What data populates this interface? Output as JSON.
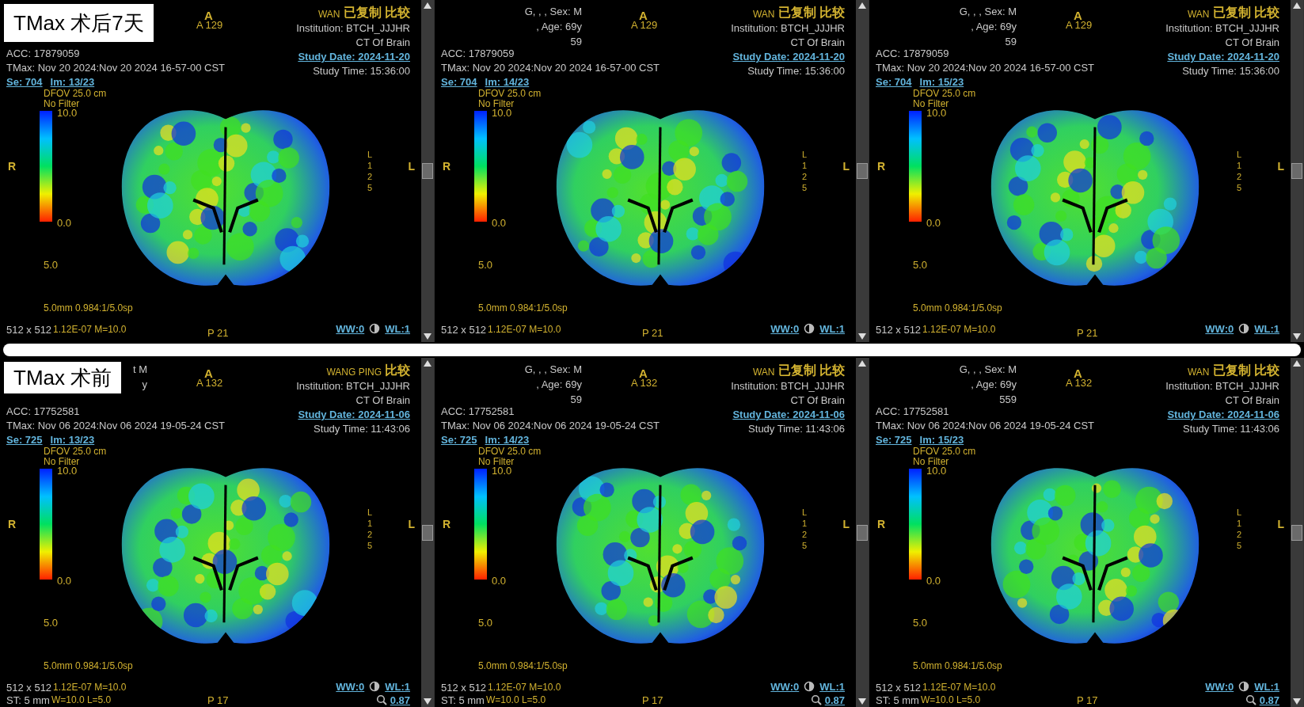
{
  "rows": [
    {
      "label": "TMax 术后7天",
      "viewports": [
        {
          "orientation": "A",
          "position": "A 129",
          "name": "WAN",
          "tags": "已复制 比较",
          "institution": "Institution: BTCH_JJJHR",
          "protocol": "CT Of Brain",
          "study_date": "Study Date: 2024-11-20",
          "study_time": "Study Time: 15:36:00",
          "acc": "ACC: 17879059",
          "tmax": "TMax: Nov 20 2024:Nov 20 2024 16-57-00 CST",
          "series": "Se: 704",
          "image": "Im: 13/23",
          "dfov": "DFOV 25.0 cm",
          "filter": "No Filter",
          "scale_max": "10.0",
          "scale_min": "0.0",
          "side_right": "R",
          "side_left": "L",
          "marks": [
            "L",
            "1",
            "2",
            "5"
          ],
          "window_value": "5.0",
          "thickness": "5.0mm 0.984:1/5.0sp",
          "matrix": "512 x 512",
          "calib": "1.12E-07 M=10.0",
          "ww": "WW:0",
          "wl": "WL:1",
          "bottom_position": "P 21"
        },
        {
          "patient_lines": [
            "G, , , Sex: M",
            ", Age: 69y",
            "59"
          ],
          "orientation": "A",
          "position": "A 129",
          "name": "WAN",
          "tags": "已复制 比较",
          "institution": "Institution: BTCH_JJJHR",
          "protocol": "CT Of Brain",
          "study_date": "Study Date: 2024-11-20",
          "study_time": "Study Time: 15:36:00",
          "acc": "ACC: 17879059",
          "tmax": "TMax: Nov 20 2024:Nov 20 2024 16-57-00 CST",
          "series": "Se: 704",
          "image": "Im: 14/23",
          "dfov": "DFOV 25.0 cm",
          "filter": "No Filter",
          "scale_max": "10.0",
          "scale_min": "0.0",
          "side_right": "R",
          "side_left": "L",
          "marks": [
            "L",
            "1",
            "2",
            "5"
          ],
          "window_value": "5.0",
          "thickness": "5.0mm 0.984:1/5.0sp",
          "matrix": "512 x 512",
          "calib": "1.12E-07 M=10.0",
          "ww": "WW:0",
          "wl": "WL:1",
          "bottom_position": "P 21"
        },
        {
          "patient_lines": [
            "G, , , Sex: M",
            ", Age: 69y",
            "59"
          ],
          "orientation": "A",
          "position": "A 129",
          "name": "WAN",
          "tags": "已复制 比较",
          "institution": "Institution: BTCH_JJJHR",
          "protocol": "CT Of Brain",
          "study_date": "Study Date: 2024-11-20",
          "study_time": "Study Time: 15:36:00",
          "acc": "ACC: 17879059",
          "tmax": "TMax: Nov 20 2024:Nov 20 2024 16-57-00 CST",
          "series": "Se: 704",
          "image": "Im: 15/23",
          "dfov": "DFOV 25.0 cm",
          "filter": "No Filter",
          "scale_max": "10.0",
          "scale_min": "0.0",
          "side_right": "R",
          "side_left": "L",
          "marks": [
            "L",
            "1",
            "2",
            "5"
          ],
          "window_value": "5.0",
          "thickness": "5.0mm 0.984:1/5.0sp",
          "matrix": "512 x 512",
          "calib": "1.12E-07 M=10.0",
          "ww": "WW:0",
          "wl": "WL:1",
          "bottom_position": "P 21"
        }
      ]
    },
    {
      "label": "TMax 术前",
      "viewports": [
        {
          "patient_lines": [
            "t M",
            "y"
          ],
          "orientation": "A",
          "position": "A 132",
          "name": "WANG PING",
          "tags": "比较",
          "institution": "Institution: BTCH_JJJHR",
          "protocol": "CT Of Brain",
          "study_date": "Study Date: 2024-11-06",
          "study_time": "Study Time: 11:43:06",
          "acc": "ACC: 17752581",
          "tmax": "TMax: Nov 06 2024:Nov 06 2024 19-05-24 CST",
          "series": "Se: 725",
          "image": "Im: 13/23",
          "dfov": "DFOV 25.0 cm",
          "filter": "No Filter",
          "scale_max": "10.0",
          "scale_min": "0.0",
          "side_right": "R",
          "side_left": "L",
          "marks": [
            "L",
            "1",
            "2",
            "5"
          ],
          "window_value": "5.0",
          "thickness": "5.0mm 0.984:1/5.0sp",
          "matrix": "512 x 512",
          "calib": "1.12E-07 M=10.0",
          "st": "ST: 5 mm",
          "wl_text": "W=10.0 L=5.0",
          "ww": "WW:0",
          "wl": "WL:1",
          "zoom": "0.87",
          "bottom_position": "P 17"
        },
        {
          "patient_lines": [
            "G, , , Sex: M",
            ", Age: 69y",
            "59"
          ],
          "orientation": "A",
          "position": "A 132",
          "name": "WAN",
          "tags": "已复制 比较",
          "institution": "Institution: BTCH_JJJHR",
          "protocol": "CT Of Brain",
          "study_date": "Study Date: 2024-11-06",
          "study_time": "Study Time: 11:43:06",
          "acc": "ACC: 17752581",
          "tmax": "TMax: Nov 06 2024:Nov 06 2024 19-05-24 CST",
          "series": "Se: 725",
          "image": "Im: 14/23",
          "dfov": "DFOV 25.0 cm",
          "filter": "No Filter",
          "scale_max": "10.0",
          "scale_min": "0.0",
          "side_right": "R",
          "side_left": "L",
          "marks": [
            "L",
            "1",
            "2",
            "5"
          ],
          "window_value": "5.0",
          "thickness": "5.0mm 0.984:1/5.0sp",
          "matrix": "512 x 512",
          "calib": "1.12E-07 M=10.0",
          "st": "ST: 5 mm",
          "wl_text": "W=10.0 L=5.0",
          "ww": "WW:0",
          "wl": "WL:1",
          "zoom": "0.87",
          "bottom_position": "P 17"
        },
        {
          "patient_lines": [
            "G, , , Sex: M",
            ", Age: 69y",
            "559"
          ],
          "orientation": "A",
          "position": "A 132",
          "name": "WAN",
          "tags": "已复制 比较",
          "institution": "Institution: BTCH_JJJHR",
          "protocol": "CT Of Brain",
          "study_date": "Study Date: 2024-11-06",
          "study_time": "Study Time: 11:43:06",
          "acc": "ACC: 17752581",
          "tmax": "TMax: Nov 06 2024:Nov 06 2024 19-05-24 CST",
          "series": "Se: 725",
          "image": "Im: 15/23",
          "dfov": "DFOV 25.0 cm",
          "filter": "No Filter",
          "scale_max": "10.0",
          "scale_min": "0.0",
          "side_right": "R",
          "side_left": "L",
          "marks": [
            "L",
            "1",
            "2",
            "5"
          ],
          "window_value": "5.0",
          "thickness": "5.0mm 0.984:1/5.0sp",
          "matrix": "512 x 512",
          "calib": "1.12E-07 M=10.0",
          "st": "ST: 5 mm",
          "wl_text": "W=10.0 L=5.0",
          "ww": "WW:0",
          "wl": "WL:1",
          "zoom": "0.87",
          "bottom_position": "P 17"
        }
      ]
    }
  ]
}
